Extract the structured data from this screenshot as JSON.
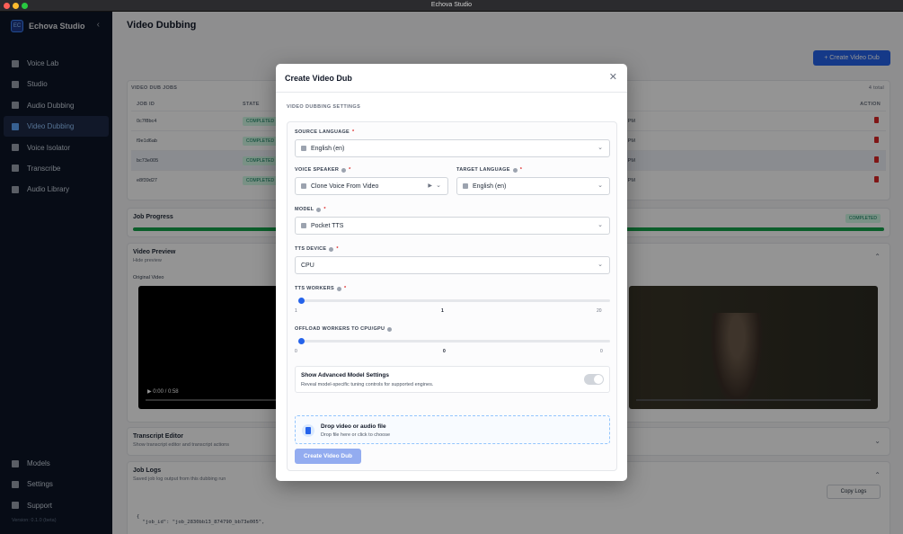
{
  "window": {
    "title": "Echova Studio"
  },
  "sidebar": {
    "brand": "Echova Studio",
    "items": [
      {
        "label": "Voice Lab",
        "icon": "voice-lab-icon"
      },
      {
        "label": "Studio",
        "icon": "mic-icon"
      },
      {
        "label": "Audio Dubbing",
        "icon": "file-icon"
      },
      {
        "label": "Video Dubbing",
        "icon": "video-icon",
        "active": true
      },
      {
        "label": "Voice Isolator",
        "icon": "headphones-icon"
      },
      {
        "label": "Transcribe",
        "icon": "caption-icon"
      },
      {
        "label": "Audio Library",
        "icon": "folder-icon"
      }
    ],
    "bottom_items": [
      {
        "label": "Models",
        "icon": "models-icon"
      },
      {
        "label": "Settings",
        "icon": "gear-icon"
      },
      {
        "label": "Support",
        "icon": "help-icon"
      }
    ],
    "version": "Version: 0.1.0 (beta)"
  },
  "main": {
    "title": "Video Dubbing",
    "create_button": "+ Create Video Dub",
    "jobs": {
      "section_label": "VIDEO DUB JOBS",
      "count": "4 total",
      "headers": [
        "JOB ID",
        "STATE",
        "ACTION"
      ],
      "rows": [
        {
          "id": "0c7f8bc4",
          "state": "COMPLETED",
          "time": "10 PM"
        },
        {
          "id": "f9e1d6ab",
          "state": "COMPLETED",
          "time": "58 PM"
        },
        {
          "id": "bc73e005",
          "state": "COMPLETED",
          "time": "07 PM"
        },
        {
          "id": "e8f39d27",
          "state": "COMPLETED",
          "time": "26 PM"
        }
      ]
    },
    "progress": {
      "title": "Job Progress",
      "status": "COMPLETED"
    },
    "preview": {
      "title": "Video Preview",
      "subtitle": "Hide preview",
      "original_label": "Original Video",
      "time": "0:00 / 0:58"
    },
    "editor": {
      "title": "Transcript Editor",
      "subtitle": "Show transcript editor and transcript actions"
    },
    "logs": {
      "title": "Job Logs",
      "subtitle": "Saved job log output from this dubbing run",
      "copy_button": "Copy Logs",
      "code_lines": [
        "{",
        "  \"job_id\": \"job_2830bb13_874790_bb73e005\","
      ]
    }
  },
  "modal": {
    "title": "Create Video Dub",
    "section_label": "VIDEO DUBBING SETTINGS",
    "source_language": {
      "label": "SOURCE LANGUAGE",
      "value": "English (en)"
    },
    "voice_speaker": {
      "label": "VOICE SPEAKER",
      "value": "Clone Voice From Video"
    },
    "target_language": {
      "label": "TARGET LANGUAGE",
      "value": "English (en)"
    },
    "model": {
      "label": "MODEL",
      "value": "Pocket TTS"
    },
    "tts_device": {
      "label": "TTS DEVICE",
      "value": "CPU"
    },
    "tts_workers": {
      "label": "TTS WORKERS",
      "min": "1",
      "current": "1",
      "max": "20",
      "fraction": 0
    },
    "offload_workers": {
      "label": "OFFLOAD WORKERS TO CPU/GPU",
      "min": "0",
      "current": "0",
      "max": "0",
      "fraction": 0
    },
    "advanced": {
      "title": "Show Advanced Model Settings",
      "subtitle": "Reveal model-specific tuning controls for supported engines.",
      "enabled": false
    },
    "drop": {
      "title": "Drop video or audio file",
      "subtitle": "Drop file here or click to choose"
    },
    "submit_label": "Create Video Dub",
    "required_mark": "*"
  },
  "colors": {
    "accent": "#2563eb",
    "success": "#16a34a",
    "danger": "#dc2626",
    "sidebar_bg": "#0d1526"
  }
}
